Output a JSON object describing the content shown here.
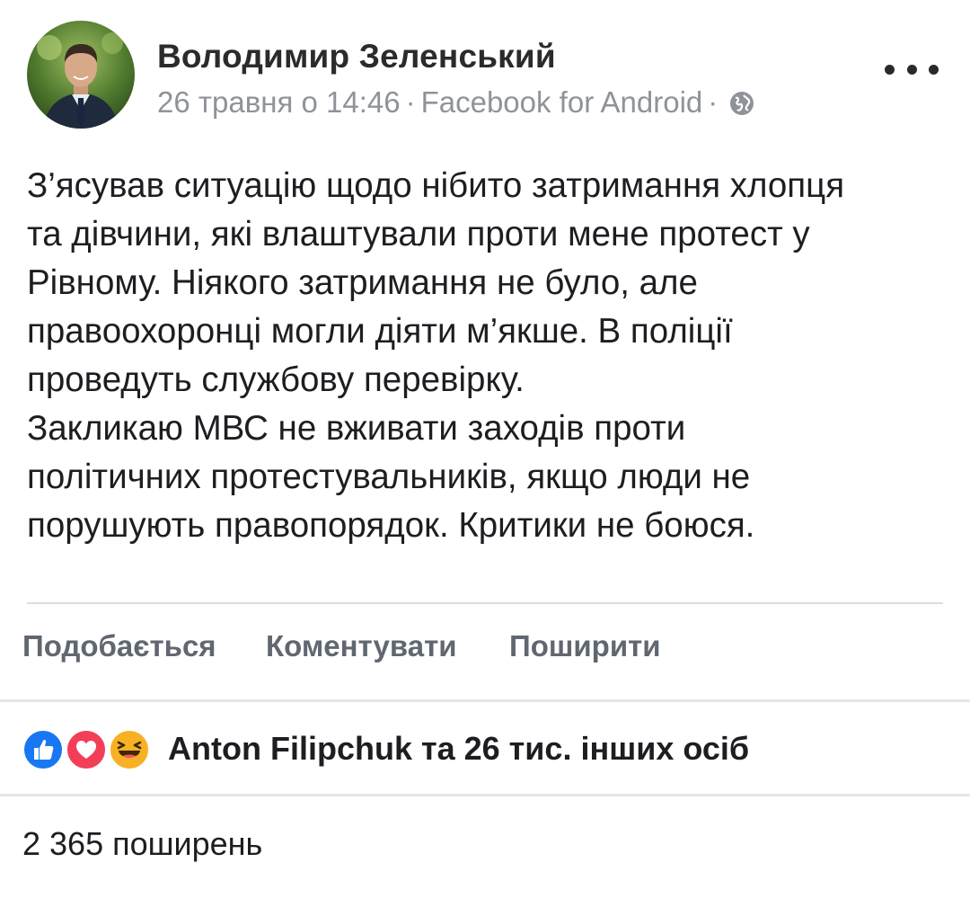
{
  "post": {
    "author": "Володимир Зеленський",
    "meta": {
      "date": "26 травня о 14:46",
      "separator": "·",
      "source": "Facebook for Android",
      "privacy_icon": "globe-icon"
    },
    "text_lines": [
      "З’ясував ситуацію щодо нібито затримання хлопця",
      "та дівчини, які влаштували проти мене протест у",
      "Рівному. Ніякого затримання не було, але",
      "правоохоронці могли діяти м’якше. В поліції",
      "проведуть службову перевірку.",
      "Закликаю МВС не вживати заходів проти",
      "політичних протестувальників, якщо люди не",
      "порушують правопорядок. Критики не боюся."
    ]
  },
  "actions": {
    "like_label": "Подобається",
    "comment_label": "Коментувати",
    "share_label": "Поширити"
  },
  "reactions": {
    "icons": [
      "like-reaction-icon",
      "love-reaction-icon",
      "haha-reaction-icon"
    ],
    "summary": "Anton Filipchuk та 26 тис. інших осіб"
  },
  "shares": {
    "text": "2 365 поширень"
  },
  "colors": {
    "like_blue": "#1877f2",
    "love_red": "#f33e58",
    "haha_yellow": "#f7b125",
    "secondary_text": "#8f9399",
    "action_text": "#606770"
  }
}
